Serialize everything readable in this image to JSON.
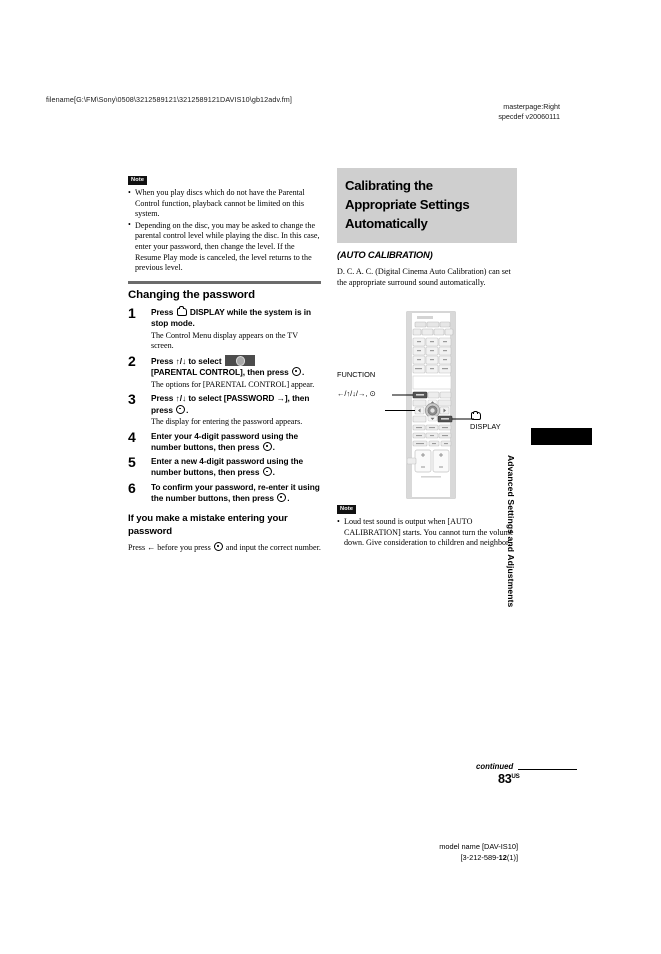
{
  "header": {
    "filename": "filename[G:\\FM\\Sony\\0508\\3212589121\\3212589121DAVIS10\\gb12adv.fm]",
    "masterpage": "masterpage:Right",
    "specdef": "specdef v20060111"
  },
  "left_column": {
    "note_label": "Note",
    "notes": [
      "When you play discs which do not have the Parental Control function, playback cannot be limited on this system.",
      "Depending on the disc, you may be asked to change the parental control level while playing the disc. In this case, enter your password, then change the level. If the Resume Play mode is canceled, the level returns to the previous level."
    ],
    "section_heading": "Changing the password",
    "steps": [
      {
        "num": "1",
        "title_pre": "Press ",
        "title_icon": "display-icon",
        "title_post": " DISPLAY while the system is in stop mode.",
        "body": "The Control Menu display appears on the TV screen."
      },
      {
        "num": "2",
        "title_pre": "Press ↑/↓ to select ",
        "title_icon": "parental-control-chip-icon",
        "title_mid": "[PARENTAL CONTROL], then press ",
        "title_icon2": "enter-icon",
        "title_post": ".",
        "body": "The options for [PARENTAL CONTROL] appear."
      },
      {
        "num": "3",
        "title_pre": "Press ↑/↓ to select [PASSWORD →], then press ",
        "title_icon": "enter-icon",
        "title_post": ".",
        "body": "The display for entering the password appears."
      },
      {
        "num": "4",
        "title_pre": "Enter your 4-digit password using the number buttons, then press ",
        "title_icon": "enter-icon",
        "title_post": ".",
        "body": ""
      },
      {
        "num": "5",
        "title_pre": "Enter a new 4-digit password using the number buttons, then press ",
        "title_icon": "enter-icon",
        "title_post": ".",
        "body": ""
      },
      {
        "num": "6",
        "title_pre": "To confirm your password, re-enter it using the number buttons, then press ",
        "title_icon": "enter-icon",
        "title_post": ".",
        "body": ""
      }
    ],
    "mistake_heading": "If you make a mistake entering your password",
    "mistake_text_pre": "Press ← before you press ",
    "mistake_icon": "enter-icon",
    "mistake_text_post": " and input the correct number."
  },
  "right_column": {
    "heading_lines": [
      "Calibrating the",
      "Appropriate Settings",
      "Automatically"
    ],
    "heading_bg": "#cfcfcf",
    "subheading": "(AUTO CALIBRATION)",
    "intro": "D. C. A. C. (Digital Cinema Auto Calibration) can set the appropriate surround sound automatically.",
    "callouts": {
      "function": "FUNCTION",
      "arrows": "←/↑/↓/→, ⊙",
      "display": "DISPLAY"
    },
    "note_label": "Note",
    "notes": [
      "Loud test sound is output when [AUTO CALIBRATION] starts. You cannot turn the volume down. Give consideration to children and neighbor."
    ]
  },
  "edge_tab": {
    "label": "Advanced Settings and Adjustments",
    "color": "#000000"
  },
  "footer": {
    "continued": "continued",
    "page_number": "83",
    "page_suffix": "US",
    "model_name": "model name [DAV-IS10]",
    "code_pre": "[3-212-589-",
    "code_bold": "12",
    "code_post": "(1)]"
  }
}
